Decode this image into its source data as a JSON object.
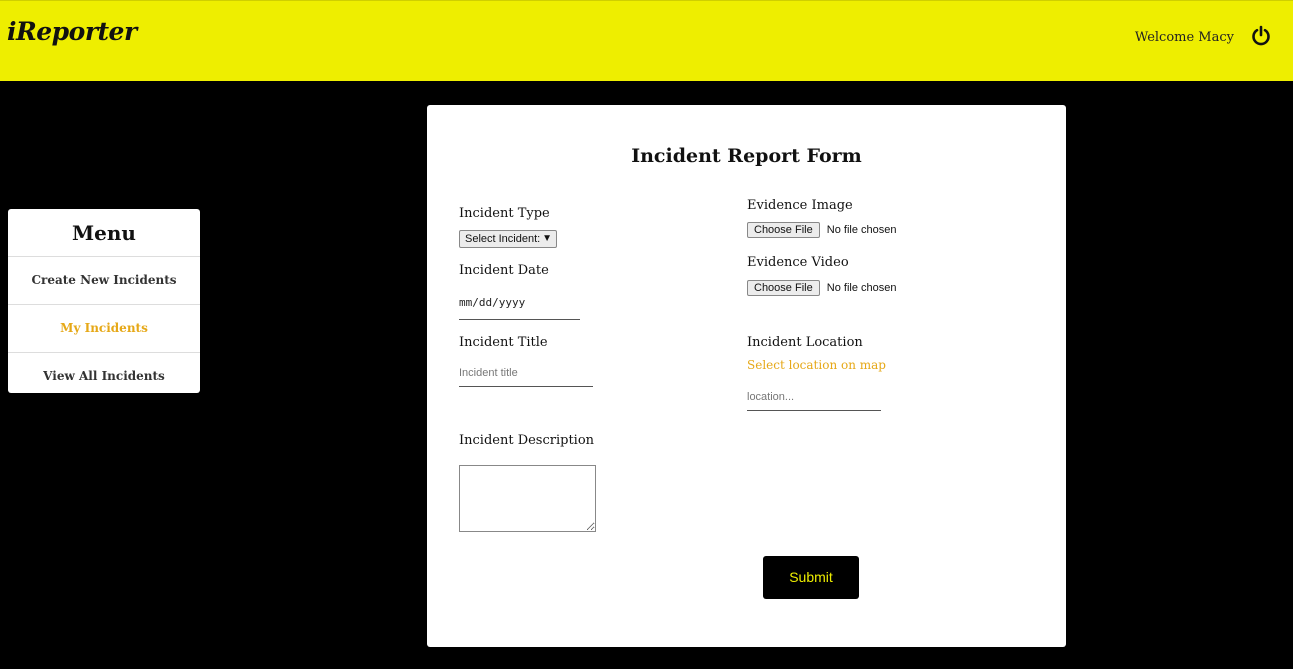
{
  "header": {
    "brand": "iReporter",
    "welcome": "Welcome Macy",
    "logout_icon": "power-icon"
  },
  "menu": {
    "title": "Menu",
    "items": [
      {
        "label": "Create New Incidents",
        "active": false
      },
      {
        "label": "My Incidents",
        "active": true
      },
      {
        "label": "View All Incidents",
        "active": false
      }
    ]
  },
  "form": {
    "title": "Incident Report Form",
    "incident_type": {
      "label": "Incident Type",
      "selected": "Select Incident:"
    },
    "incident_date": {
      "label": "Incident Date",
      "placeholder": "mm/dd/yyyy"
    },
    "incident_title": {
      "label": "Incident Title",
      "placeholder": "Incident title"
    },
    "incident_description": {
      "label": "Incident Description",
      "value": ""
    },
    "evidence_image": {
      "label": "Evidence Image",
      "button": "Choose File",
      "status": "No file chosen"
    },
    "evidence_video": {
      "label": "Evidence Video",
      "button": "Choose File",
      "status": "No file chosen"
    },
    "incident_location": {
      "label": "Incident Location",
      "map_link": "Select location on map",
      "placeholder": "location..."
    },
    "submit_label": "Submit"
  },
  "colors": {
    "header_bg": "#eeee00",
    "page_bg": "#000000",
    "accent": "#e6a817",
    "submit_text": "#eeee00"
  }
}
